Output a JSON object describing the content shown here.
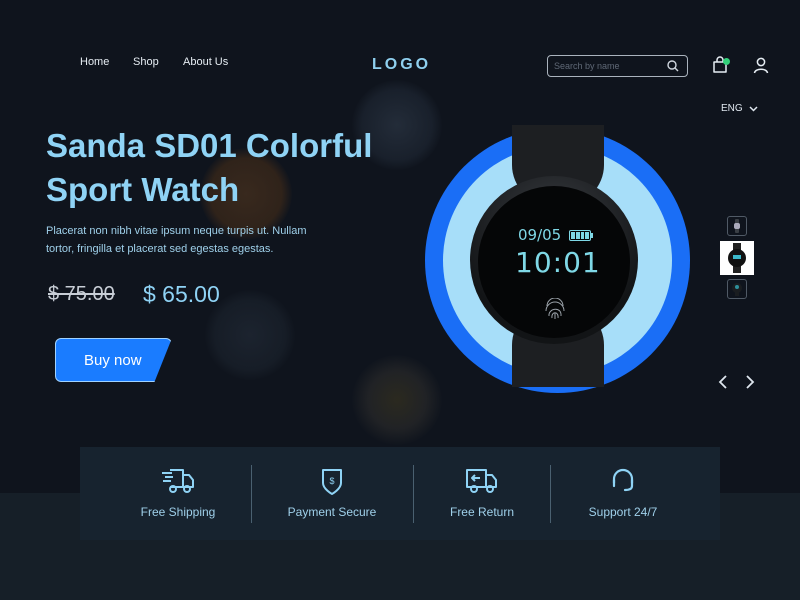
{
  "header": {
    "nav": [
      {
        "label": "Home"
      },
      {
        "label": "Shop"
      },
      {
        "label": "About Us"
      }
    ],
    "logo": "LOGO",
    "search_placeholder": "Search by name",
    "language": "ENG",
    "cart_notification": true
  },
  "hero": {
    "title_line1": "Sanda SD01 Colorful",
    "title_line2": "Sport Watch",
    "description": "Placerat non nibh vitae ipsum neque turpis ut. Nullam tortor, fringilla et placerat sed egestas egestas.",
    "old_price": "$ 75.00",
    "new_price": "$ 65.00",
    "cta_label": "Buy now"
  },
  "watch": {
    "date": "09/05",
    "time": "10:01",
    "battery_level": 1.0
  },
  "gallery": {
    "thumbnails": [
      {
        "name": "watch-side-view",
        "selected": false
      },
      {
        "name": "watch-front-view",
        "selected": true
      },
      {
        "name": "watch-top-view",
        "selected": false
      }
    ],
    "prev_label": "‹",
    "next_label": "›"
  },
  "features": [
    {
      "icon": "truck-fast-icon",
      "label": "Free Shipping"
    },
    {
      "icon": "shield-dollar-icon",
      "label": "Payment Secure"
    },
    {
      "icon": "truck-return-icon",
      "label": "Free Return"
    },
    {
      "icon": "headset-icon",
      "label": "Support 24/7"
    }
  ],
  "colors": {
    "accent": "#1a7cff",
    "title": "#8fd3f5",
    "ring_outer": "#1a6ef6",
    "ring_inner": "#a7def9",
    "background": "#0f141d"
  }
}
